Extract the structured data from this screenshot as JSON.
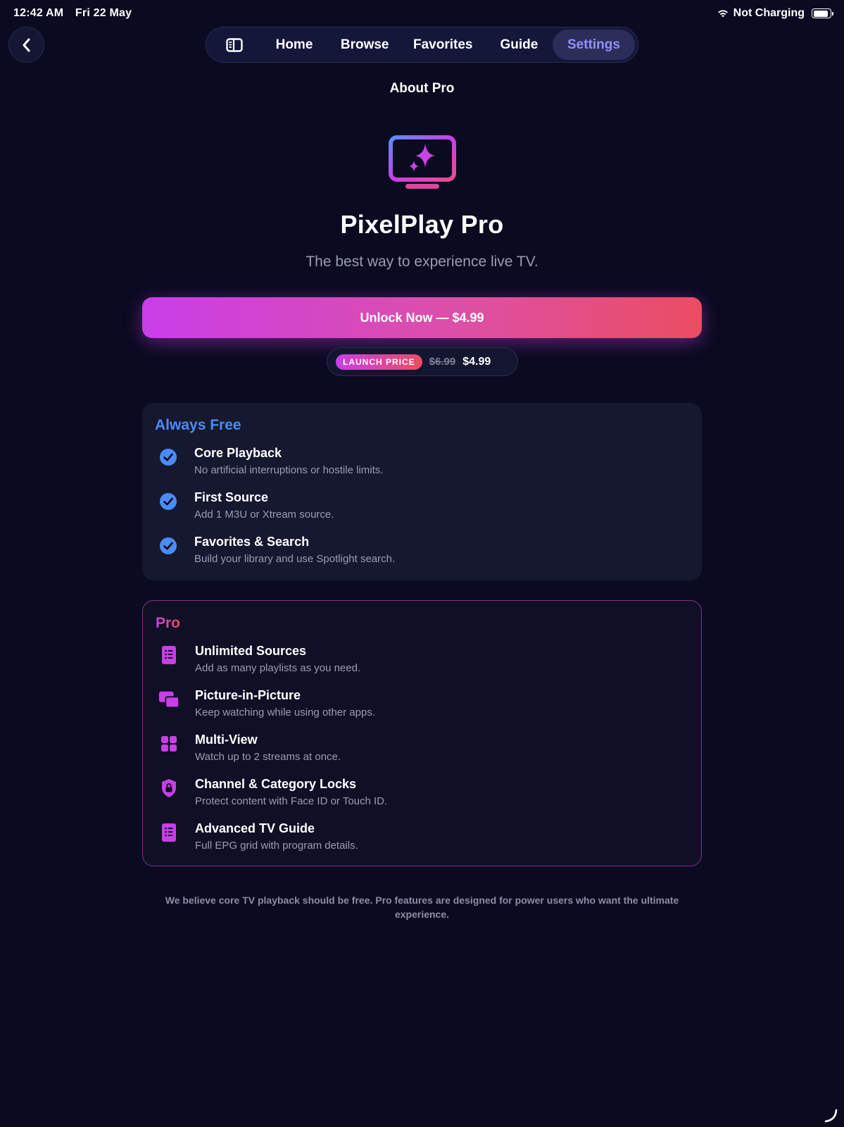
{
  "status_bar": {
    "time": "12:42 AM",
    "date": "Fri 22 May",
    "charging": "Not Charging",
    "battery_level": 0.9
  },
  "nav": {
    "items": [
      {
        "label": "Home"
      },
      {
        "label": "Browse"
      },
      {
        "label": "Favorites"
      },
      {
        "label": "Guide"
      },
      {
        "label": "Settings"
      }
    ],
    "active": "Settings"
  },
  "page": {
    "title": "About Pro"
  },
  "hero": {
    "app_name": "PixelPlay Pro",
    "tagline": "The best way to experience live TV.",
    "icon": "tv-sparkles-icon"
  },
  "purchase": {
    "unlock_label": "Unlock Now — $4.99",
    "badge": "LAUNCH PRICE",
    "old_price": "$6.99",
    "new_price": "$4.99"
  },
  "free_section": {
    "heading": "Always Free",
    "accent": "#4a8cf5",
    "features": [
      {
        "title": "Core Playback",
        "desc": "No artificial interruptions or hostile limits.",
        "icon": "checkmark-circle-icon"
      },
      {
        "title": "First Source",
        "desc": "Add 1 M3U or Xtream source.",
        "icon": "checkmark-circle-icon"
      },
      {
        "title": "Favorites & Search",
        "desc": "Build your library and use Spotlight search.",
        "icon": "checkmark-circle-icon"
      }
    ]
  },
  "pro_section": {
    "heading": "Pro",
    "accent": "#c93ee8",
    "features": [
      {
        "title": "Unlimited Sources",
        "desc": "Add as many playlists as you need.",
        "icon": "list-document-icon"
      },
      {
        "title": "Picture-in-Picture",
        "desc": "Keep watching while using other apps.",
        "icon": "pip-icon"
      },
      {
        "title": "Multi-View",
        "desc": "Watch up to 2 streams at once.",
        "icon": "grid-icon"
      },
      {
        "title": "Channel & Category Locks",
        "desc": "Protect content with Face ID or Touch ID.",
        "icon": "lock-shield-icon"
      },
      {
        "title": "Advanced TV Guide",
        "desc": "Full EPG grid with program details.",
        "icon": "list-document-icon"
      }
    ]
  },
  "footer": {
    "note": "We believe core TV playback should be free. Pro features are designed for power users who want the ultimate experience."
  }
}
